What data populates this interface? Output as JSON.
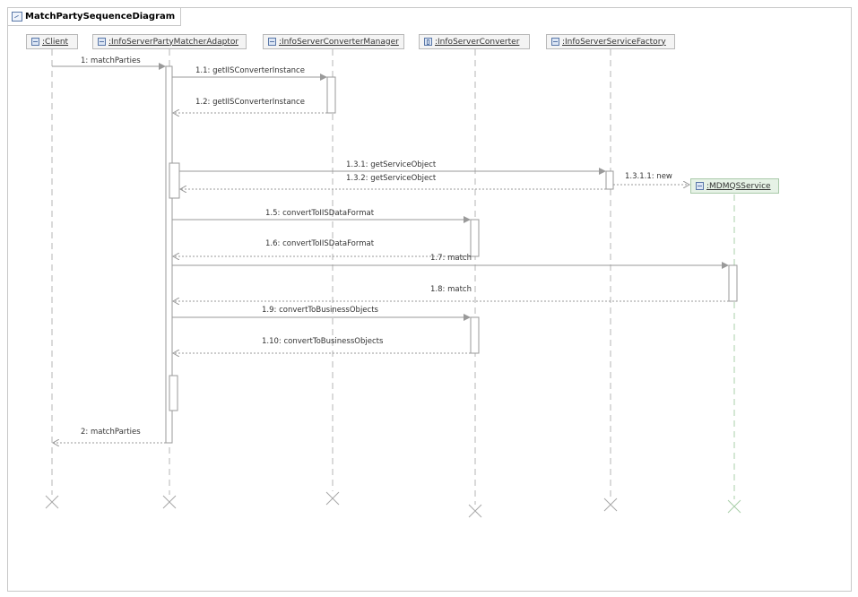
{
  "diagram": {
    "title": "MatchPartySequenceDiagram"
  },
  "lifelines": [
    {
      "id": "client",
      "name": ":Client",
      "icon": "class-icon"
    },
    {
      "id": "adaptor",
      "name": ":InfoServerPartyMatcherAdaptor",
      "icon": "class-icon"
    },
    {
      "id": "convmgr",
      "name": ":InfoServerConverterManager",
      "icon": "class-icon"
    },
    {
      "id": "converter",
      "name": ":InfoServerConverter",
      "icon": "component-icon"
    },
    {
      "id": "factory",
      "name": ":InfoServerServiceFactory",
      "icon": "class-icon"
    },
    {
      "id": "mdmqs",
      "name": ":MDMQSService",
      "icon": "class-icon",
      "created": true
    }
  ],
  "messages": [
    {
      "label": "1: matchParties",
      "from": "client",
      "to": "adaptor",
      "kind": "call"
    },
    {
      "label": "1.1: getIISConverterInstance",
      "from": "adaptor",
      "to": "convmgr",
      "kind": "call"
    },
    {
      "label": "1.2: getIISConverterInstance",
      "from": "convmgr",
      "to": "adaptor",
      "kind": "return"
    },
    {
      "label": "1.3.1: getServiceObject",
      "from": "adaptor",
      "to": "factory",
      "kind": "call"
    },
    {
      "label": "1.3.2: getServiceObject",
      "from": "factory",
      "to": "adaptor",
      "kind": "return"
    },
    {
      "label": "1.3.1.1: new",
      "from": "factory",
      "to": "mdmqs",
      "kind": "create"
    },
    {
      "label": "1.5: convertToIISDataFormat",
      "from": "adaptor",
      "to": "converter",
      "kind": "call"
    },
    {
      "label": "1.6: convertToIISDataFormat",
      "from": "converter",
      "to": "adaptor",
      "kind": "return"
    },
    {
      "label": "1.7: match",
      "from": "adaptor",
      "to": "mdmqs",
      "kind": "call"
    },
    {
      "label": "1.8: match",
      "from": "mdmqs",
      "to": "adaptor",
      "kind": "return"
    },
    {
      "label": "1.9: convertToBusinessObjects",
      "from": "adaptor",
      "to": "converter",
      "kind": "call"
    },
    {
      "label": "1.10: convertToBusinessObjects",
      "from": "converter",
      "to": "adaptor",
      "kind": "return"
    },
    {
      "label": "2: matchParties",
      "from": "adaptor",
      "to": "client",
      "kind": "return"
    }
  ],
  "colors": {
    "line": "#a0a0a0",
    "activation_border": "#9a9a9a",
    "created_lifeline": "#a9cfa9"
  }
}
